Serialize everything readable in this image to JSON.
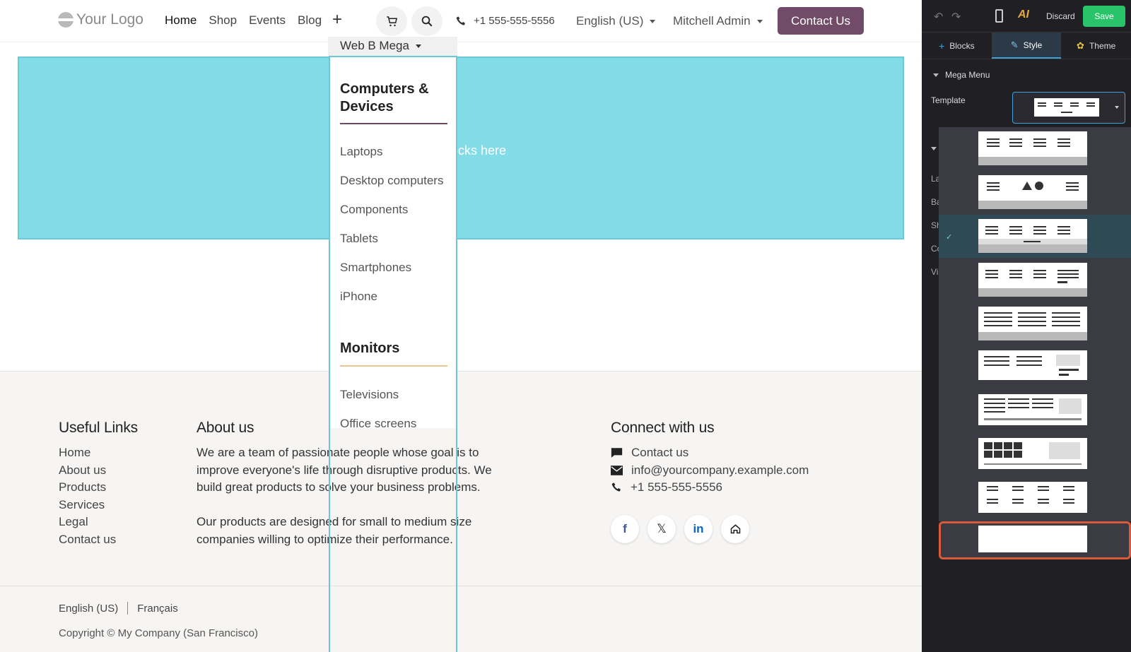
{
  "navbar": {
    "logo_text": "Your Logo",
    "links": [
      "Home",
      "Shop",
      "Events",
      "Blog"
    ],
    "phone": "+1 555-555-5556",
    "language": "English (US)",
    "user": "Mitchell Admin",
    "contact_button": "Contact Us",
    "mega_toggle": "Web B Mega"
  },
  "hero": {
    "drop_hint": "ocks here"
  },
  "mega_menu": {
    "categories": [
      {
        "title": "Computers & Devices",
        "items": [
          "Laptops",
          "Desktop computers",
          "Components",
          "Tablets",
          "Smartphones",
          "iPhone"
        ]
      },
      {
        "title": "Monitors",
        "items": [
          "Televisions",
          "Office screens"
        ]
      }
    ]
  },
  "footer": {
    "useful_links_title": "Useful Links",
    "useful_links": [
      "Home",
      "About us",
      "Products",
      "Services",
      "Legal",
      "Contact us"
    ],
    "about_title": "About us",
    "about_p1": "We are a team of passionate people whose goal is to improve everyone's life through disruptive products. We build great products to solve your business problems.",
    "about_p2": "Our products are designed for small to medium size companies willing to optimize their performance.",
    "connect_title": "Connect with us",
    "connect_contact": "Contact us",
    "connect_email": "info@yourcompany.example.com",
    "connect_phone": "+1 555-555-5556",
    "lang_en": "English (US)",
    "lang_fr": "Français",
    "copyright": "Copyright © My Company (San Francisco)"
  },
  "editor": {
    "discard": "Discard",
    "save": "Save",
    "tabs": [
      "Blocks",
      "Style",
      "Theme"
    ],
    "active_tab": "Style",
    "section": "Mega Menu",
    "template_label": "Template",
    "cut_labels": [
      "La",
      "Ba",
      "Sh",
      "Co",
      "Vi"
    ],
    "selected_template_index": 2,
    "highlighted_template_index": 9,
    "template_count": 10,
    "colors": {
      "save_bg": "#29c46a",
      "accent": "#3ea3d9",
      "highlight": "#d85a3a"
    }
  },
  "colors": {
    "brand": "#714b67",
    "hero_bg": "#82dce8",
    "footer_bg": "#f6f5f4"
  }
}
